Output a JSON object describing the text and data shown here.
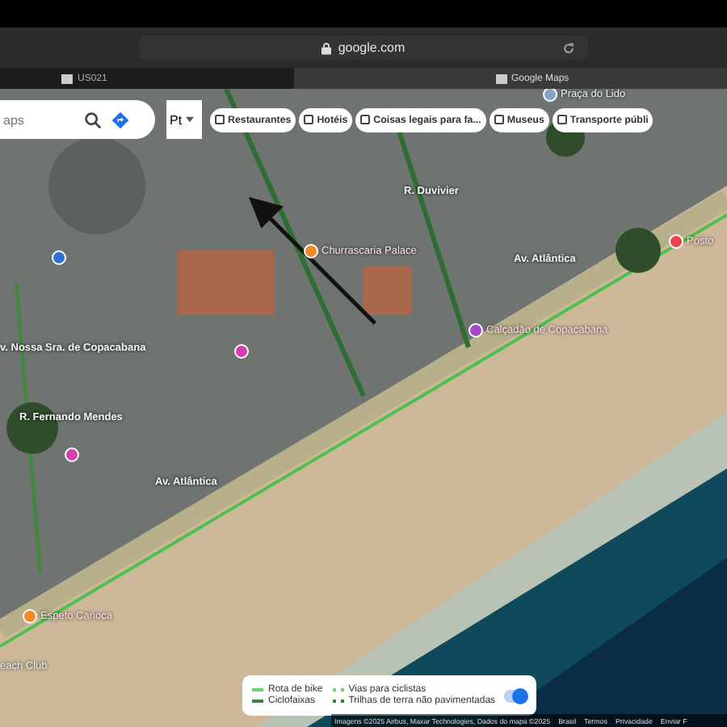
{
  "browser": {
    "url": "google.com",
    "tabs": [
      {
        "title": "US021",
        "selected": false
      },
      {
        "title": "Google Maps",
        "selected": true
      }
    ]
  },
  "search": {
    "placeholder": "aps"
  },
  "layer_button": {
    "label": "Pt"
  },
  "chips": [
    "Restaurantes",
    "Hotéis",
    "Coisas legais para fa...",
    "Museus",
    "Transporte públi"
  ],
  "map_labels": [
    {
      "text": "Praça do Lido",
      "kind": "place",
      "color": "#8aa4c8"
    },
    {
      "text": "Churrascaria Palace",
      "kind": "poi",
      "color": "#f08a24"
    },
    {
      "text": "R. Duvivier",
      "kind": "street"
    },
    {
      "text": "Av. Atlântica",
      "kind": "street"
    },
    {
      "text": "Posto",
      "kind": "poi",
      "color": "#e8434e"
    },
    {
      "text": "Calçadão de Copacabana",
      "kind": "poi",
      "color": "#a447c9"
    },
    {
      "text": "v. Nossa Sra. de Copacabana",
      "kind": "street"
    },
    {
      "text": "R. Fernando Mendes",
      "kind": "street"
    },
    {
      "text": "Av. Atlântica",
      "kind": "street"
    },
    {
      "text": "Espeto Carioca",
      "kind": "poi",
      "color": "#f08a24"
    },
    {
      "text": "each Club",
      "kind": "place"
    }
  ],
  "legend": {
    "items": [
      {
        "label": "Rota de bike",
        "kind": "solid",
        "color": "#6dd36d"
      },
      {
        "label": "Vias para ciclistas",
        "kind": "dotted",
        "color": "#6dd36d"
      },
      {
        "label": "Ciclofaixas",
        "kind": "solid",
        "color": "#2e8b3a"
      },
      {
        "label": "Trilhas de terra não pavimentadas",
        "kind": "dotted",
        "color": "#2e8b3a"
      }
    ],
    "toggle_on": true
  },
  "footer": [
    "Imagens ©2025 Airbus, Maxar Technologies, Dados do mapa ©2025",
    "Brasil",
    "Termos",
    "Privacidade",
    "Enviar F"
  ]
}
